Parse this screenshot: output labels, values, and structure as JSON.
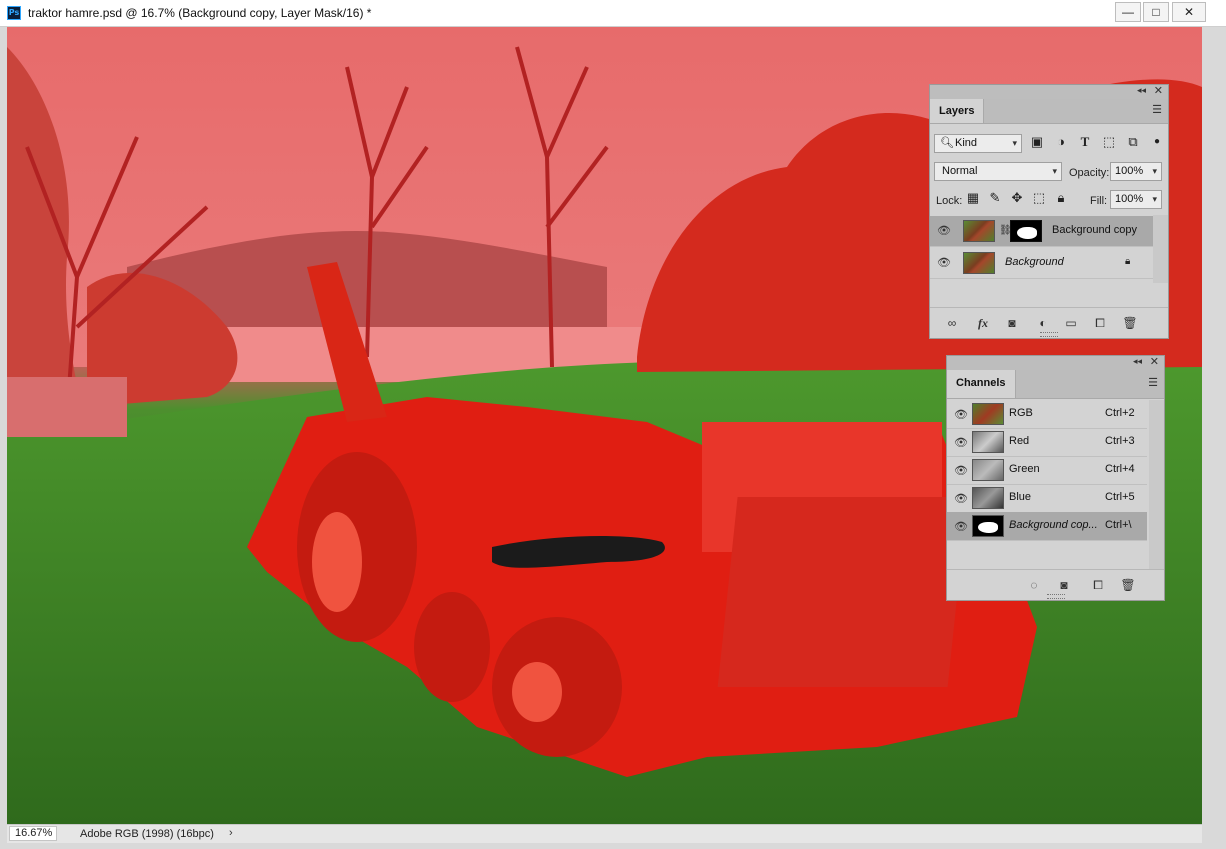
{
  "window": {
    "app_icon": "Ps",
    "title": "traktor hamre.psd @ 16.7% (Background copy, Layer Mask/16) *",
    "minimize_glyph": "—",
    "maximize_glyph": "□",
    "close_glyph": "✕"
  },
  "status_bar": {
    "zoom": "16.67%",
    "doc_info": "Adobe RGB (1998) (16bpc)",
    "arrow": "›"
  },
  "layers_panel": {
    "tab": "Layers",
    "filter_kind": "Kind",
    "blend_mode": "Normal",
    "opacity_label": "Opacity:",
    "opacity_value": "100%",
    "lock_label": "Lock:",
    "fill_label": "Fill:",
    "fill_value": "100%",
    "layers": [
      {
        "name": "Background copy",
        "selected": true,
        "has_mask": true
      },
      {
        "name": "Background",
        "selected": false,
        "locked": true
      }
    ],
    "footer_icons": [
      "link-icon",
      "fx-icon",
      "add-mask-icon",
      "adjustment-icon",
      "folder-icon",
      "new-layer-icon",
      "trash-icon"
    ]
  },
  "channels_panel": {
    "tab": "Channels",
    "channels": [
      {
        "name": "RGB",
        "shortcut": "Ctrl+2"
      },
      {
        "name": "Red",
        "shortcut": "Ctrl+3"
      },
      {
        "name": "Green",
        "shortcut": "Ctrl+4"
      },
      {
        "name": "Blue",
        "shortcut": "Ctrl+5"
      },
      {
        "name": "Background cop...",
        "shortcut": "Ctrl+\\"
      }
    ],
    "footer_icons": [
      "load-selection-icon",
      "save-selection-icon",
      "new-channel-icon",
      "trash-icon"
    ]
  },
  "colors": {
    "mask_overlay": "#ff0000",
    "grass": "#3f7e25",
    "panel_bg": "#d3d3d3",
    "selected_row": "#a9a9a9"
  }
}
